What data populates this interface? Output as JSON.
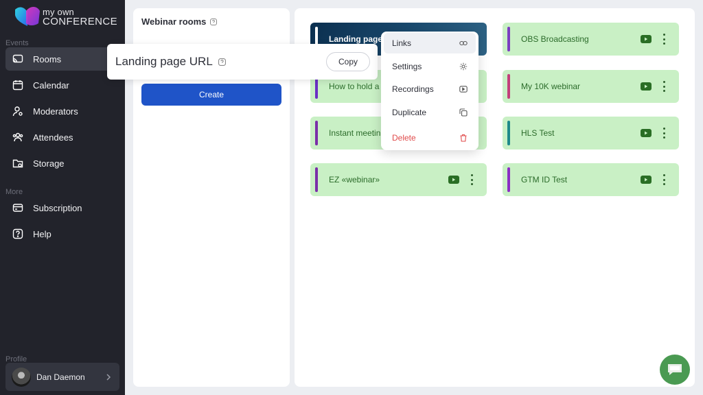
{
  "brand": {
    "line1": "my own",
    "line2": "CONFERENCE"
  },
  "sidebar": {
    "sections": {
      "events": "Events",
      "more": "More",
      "profile": "Profile"
    },
    "events_items": [
      {
        "label": "Rooms",
        "icon": "rooms-icon",
        "active": true
      },
      {
        "label": "Calendar",
        "icon": "calendar-icon"
      },
      {
        "label": "Moderators",
        "icon": "moderators-icon"
      },
      {
        "label": "Attendees",
        "icon": "attendees-icon"
      },
      {
        "label": "Storage",
        "icon": "storage-icon"
      }
    ],
    "more_items": [
      {
        "label": "Subscription",
        "icon": "subscription-icon"
      },
      {
        "label": "Help",
        "icon": "help-icon"
      }
    ],
    "profile": {
      "name": "Dan Daemon"
    }
  },
  "left_panel": {
    "title": "Webinar rooms",
    "create_label": "Create"
  },
  "url_popover": {
    "label": "Landing page URL",
    "copy_label": "Copy"
  },
  "rooms": [
    {
      "name": "Landing page",
      "bar_color": "#ffffff",
      "dark": true
    },
    {
      "name": "OBS Broadcasting",
      "bar_color": "#7a3fc0"
    },
    {
      "name": "How to hold a",
      "bar_color": "#6a2fc4"
    },
    {
      "name": "My 10K webinar",
      "bar_color": "#c2407a"
    },
    {
      "name": "Instant meetin",
      "bar_color": "#7a2fa8"
    },
    {
      "name": "HLS Test",
      "bar_color": "#1f8a8a"
    },
    {
      "name": "EZ «webinar»",
      "bar_color": "#7a2fa8"
    },
    {
      "name": "GTM ID Test",
      "bar_color": "#8a2fc4"
    }
  ],
  "context_menu": {
    "items": [
      {
        "label": "Links",
        "icon": "link-icon",
        "highlighted": true
      },
      {
        "label": "Settings",
        "icon": "gear-icon"
      },
      {
        "label": "Recordings",
        "icon": "recordings-icon"
      },
      {
        "label": "Duplicate",
        "icon": "duplicate-icon"
      },
      {
        "label": "Delete",
        "icon": "trash-icon",
        "danger": true
      }
    ]
  },
  "colors": {
    "accent": "#1f54c8",
    "card_bg": "#c9f0c5",
    "danger": "#e04a4a"
  }
}
